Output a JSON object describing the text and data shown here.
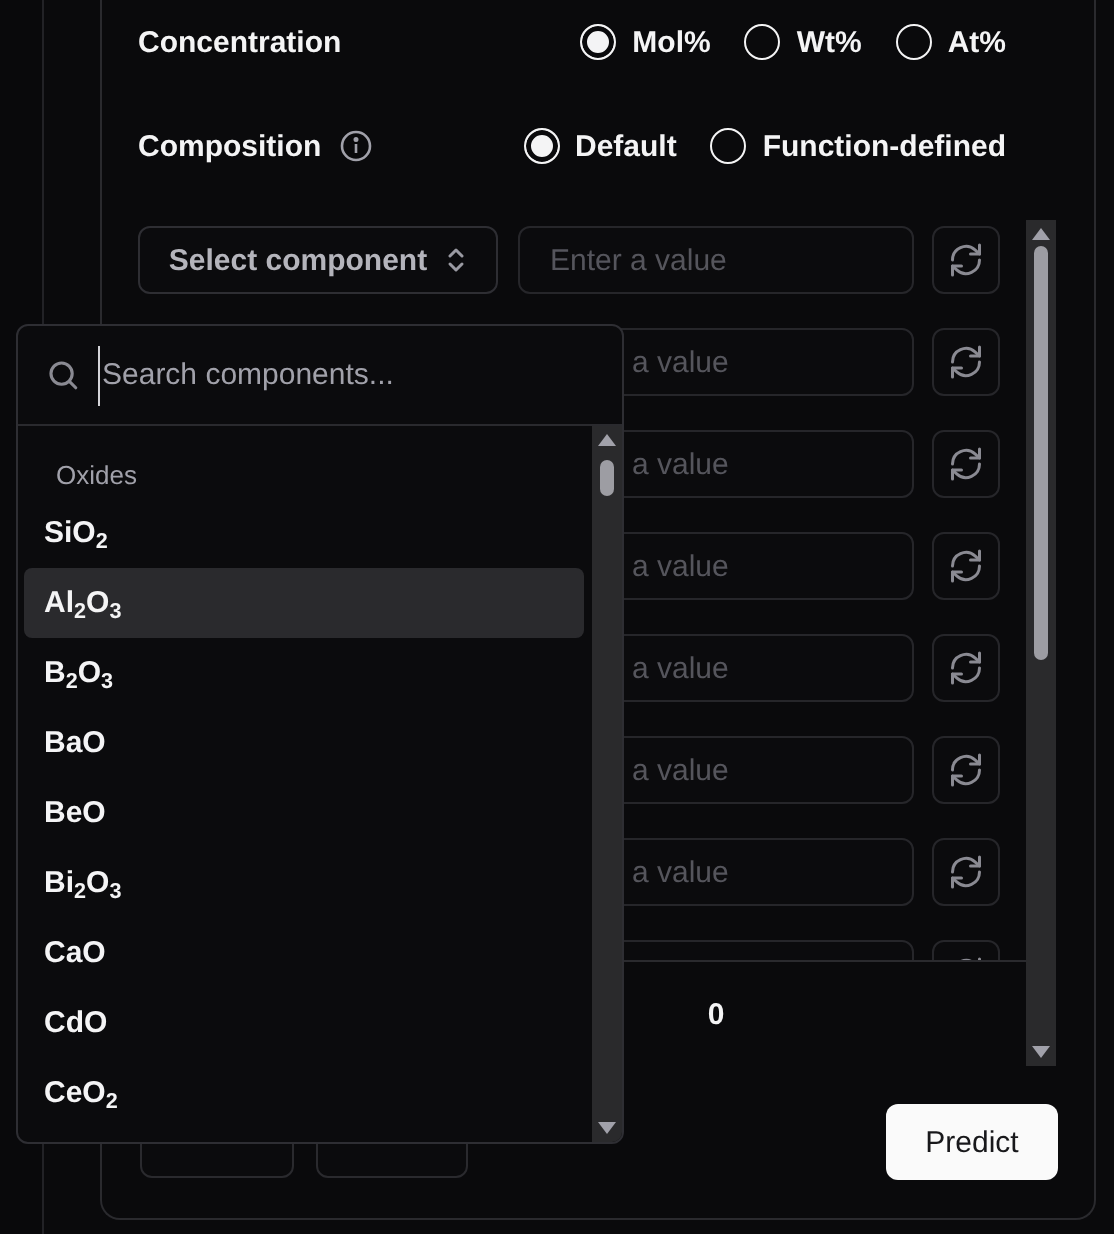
{
  "concentration": {
    "label": "Concentration",
    "options": [
      {
        "label": "Mol%",
        "selected": true
      },
      {
        "label": "Wt%",
        "selected": false
      },
      {
        "label": "At%",
        "selected": false
      }
    ]
  },
  "composition": {
    "label": "Composition",
    "options": [
      {
        "label": "Default",
        "selected": true
      },
      {
        "label": "Function-defined",
        "selected": false
      }
    ]
  },
  "component_rows": [
    {
      "kind": "full",
      "select_label": "Select component",
      "value_placeholder": "Enter a value"
    },
    {
      "kind": "covered",
      "value_placeholder": "a value"
    },
    {
      "kind": "covered",
      "value_placeholder": "a value"
    },
    {
      "kind": "covered",
      "value_placeholder": "a value"
    },
    {
      "kind": "covered",
      "value_placeholder": "a value"
    },
    {
      "kind": "covered",
      "value_placeholder": "a value"
    },
    {
      "kind": "covered",
      "value_placeholder": "a value"
    },
    {
      "kind": "clipped"
    }
  ],
  "total": "0",
  "covered_buttons": [
    {
      "kind": "ghost"
    },
    {
      "kind": "ghost"
    }
  ],
  "predict_button": "Predict",
  "dropdown": {
    "search_placeholder": "Search components...",
    "group": "Oxides",
    "items": [
      {
        "label": "SiO$_{2}$",
        "selected": false
      },
      {
        "label": "Al$_{2}$O$_{3}$",
        "selected": true
      },
      {
        "label": "B$_{2}$O$_{3}$",
        "selected": false
      },
      {
        "label": "BaO",
        "selected": false
      },
      {
        "label": "BeO",
        "selected": false
      },
      {
        "label": "Bi$_{2}$O$_{3}$",
        "selected": false
      },
      {
        "label": "CaO",
        "selected": false
      },
      {
        "label": "CdO",
        "selected": false
      },
      {
        "label": "CeO$_{2}$",
        "selected": false
      }
    ]
  }
}
